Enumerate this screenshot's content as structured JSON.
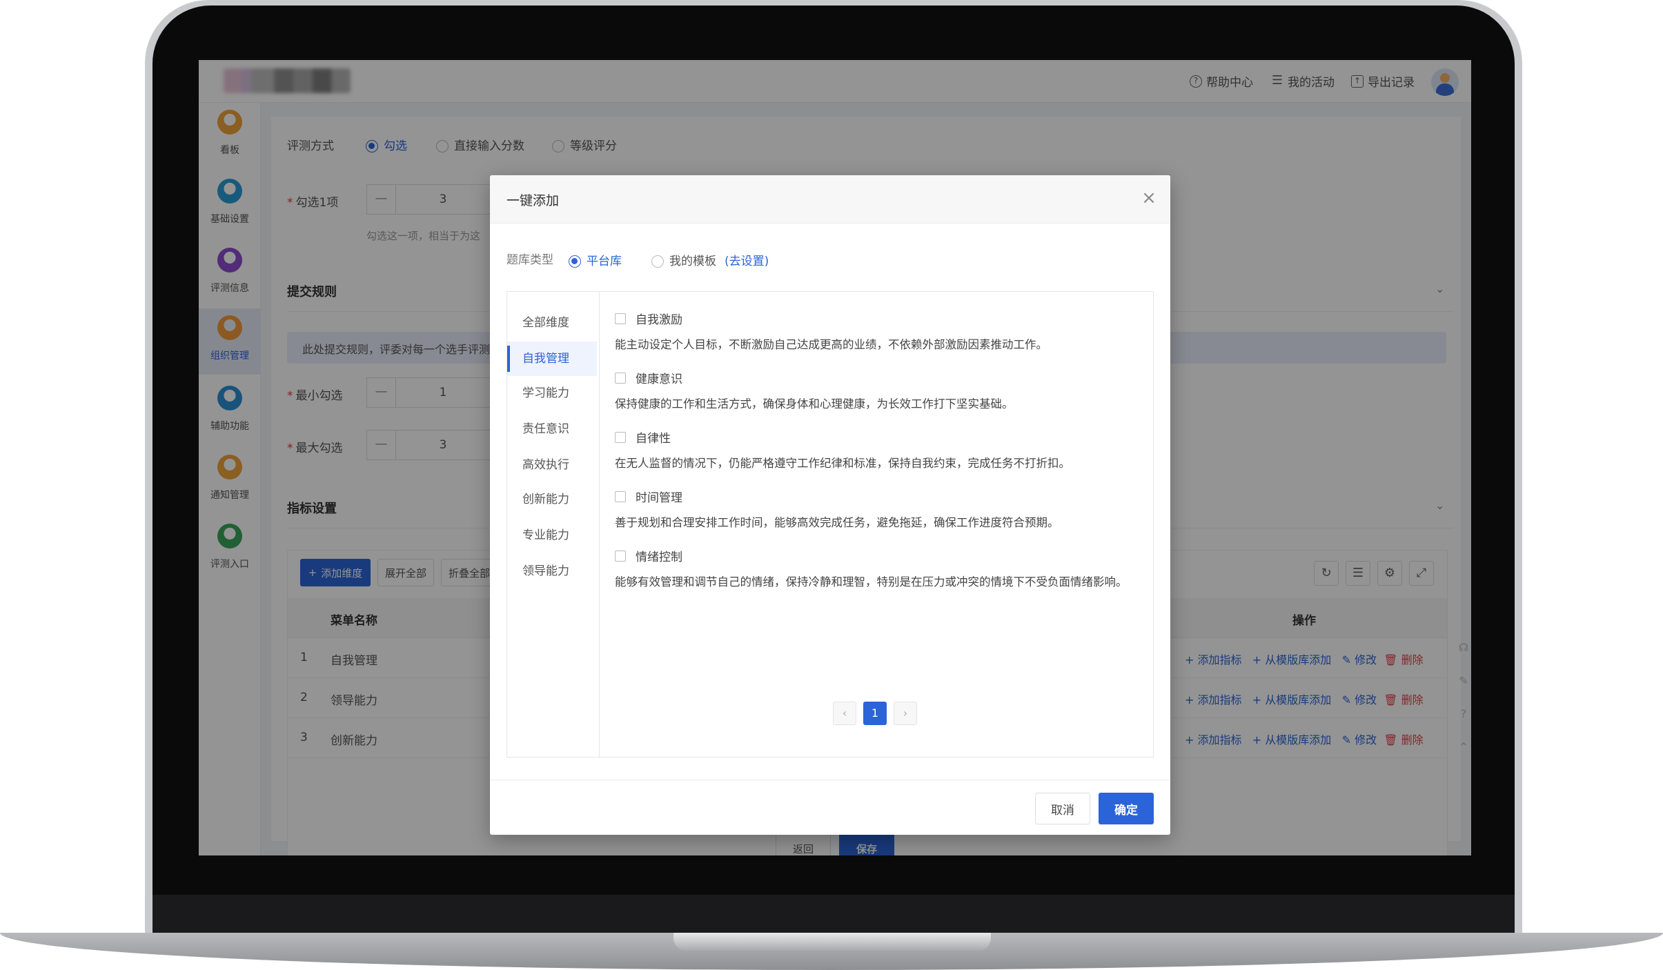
{
  "topbar": {
    "help": "帮助中心",
    "activity": "我的活动",
    "export": "导出记录"
  },
  "sidebar": {
    "items": [
      {
        "label": "看板",
        "color": "#f0a23b"
      },
      {
        "label": "基础设置",
        "color": "#2a9bd6"
      },
      {
        "label": "评测信息",
        "color": "#8e4bd1"
      },
      {
        "label": "组织管理",
        "color": "#f39a3c"
      },
      {
        "label": "辅助功能",
        "color": "#2a8fd6"
      },
      {
        "label": "通知管理",
        "color": "#f0a23b"
      },
      {
        "label": "评测入口",
        "color": "#3aa55b"
      }
    ]
  },
  "form": {
    "method_label": "评测方式",
    "method_options": [
      "勾选",
      "直接输入分数",
      "等级评分"
    ],
    "check_one_label": "勾选1项",
    "check_one_value": "3",
    "check_one_hint": "勾选这一项，相当于为这",
    "submit_rules_title": "提交规则",
    "notice": "此处提交规则，评委对每一个选手评测",
    "min_label": "最小勾选",
    "min_value": "1",
    "max_label": "最大勾选",
    "max_value": "3",
    "indicator_title": "指标设置"
  },
  "table": {
    "add_dimension": "添加维度",
    "expand_all": "展开全部",
    "collapse_all": "折叠全部",
    "col_name": "菜单名称",
    "col_action": "操作",
    "rows": [
      {
        "index": "1",
        "name": "自我管理"
      },
      {
        "index": "2",
        "name": "领导能力"
      },
      {
        "index": "3",
        "name": "创新能力"
      }
    ],
    "actions": {
      "add_indicator": "添加指标",
      "add_from_template": "从模版库添加",
      "edit": "修改",
      "delete": "删除"
    }
  },
  "bottom": {
    "back": "返回",
    "save": "保存"
  },
  "modal": {
    "title": "一键添加",
    "type_label": "题库类型",
    "type_options": [
      "平台库",
      "我的模板"
    ],
    "go_settings": "(去设置)",
    "categories": [
      "全部维度",
      "自我管理",
      "学习能力",
      "责任意识",
      "高效执行",
      "创新能力",
      "专业能力",
      "领导能力"
    ],
    "active_category": 1,
    "questions": [
      {
        "title": "自我激励",
        "desc": "能主动设定个人目标，不断激励自己达成更高的业绩，不依赖外部激励因素推动工作。"
      },
      {
        "title": "健康意识",
        "desc": "保持健康的工作和生活方式，确保身体和心理健康，为长效工作打下坚实基础。"
      },
      {
        "title": "自律性",
        "desc": "在无人监督的情况下，仍能严格遵守工作纪律和标准，保持自我约束，完成任务不打折扣。"
      },
      {
        "title": "时间管理",
        "desc": "善于规划和合理安排工作时间，能够高效完成任务，避免拖延，确保工作进度符合预期。"
      },
      {
        "title": "情绪控制",
        "desc": "能够有效管理和调节自己的情绪，保持冷静和理智，特别是在压力或冲突的情境下不受负面情绪影响。"
      }
    ],
    "page": "1",
    "cancel": "取消",
    "confirm": "确定"
  },
  "colors": {
    "accent": "#2b64d8",
    "danger": "#e0454a"
  }
}
